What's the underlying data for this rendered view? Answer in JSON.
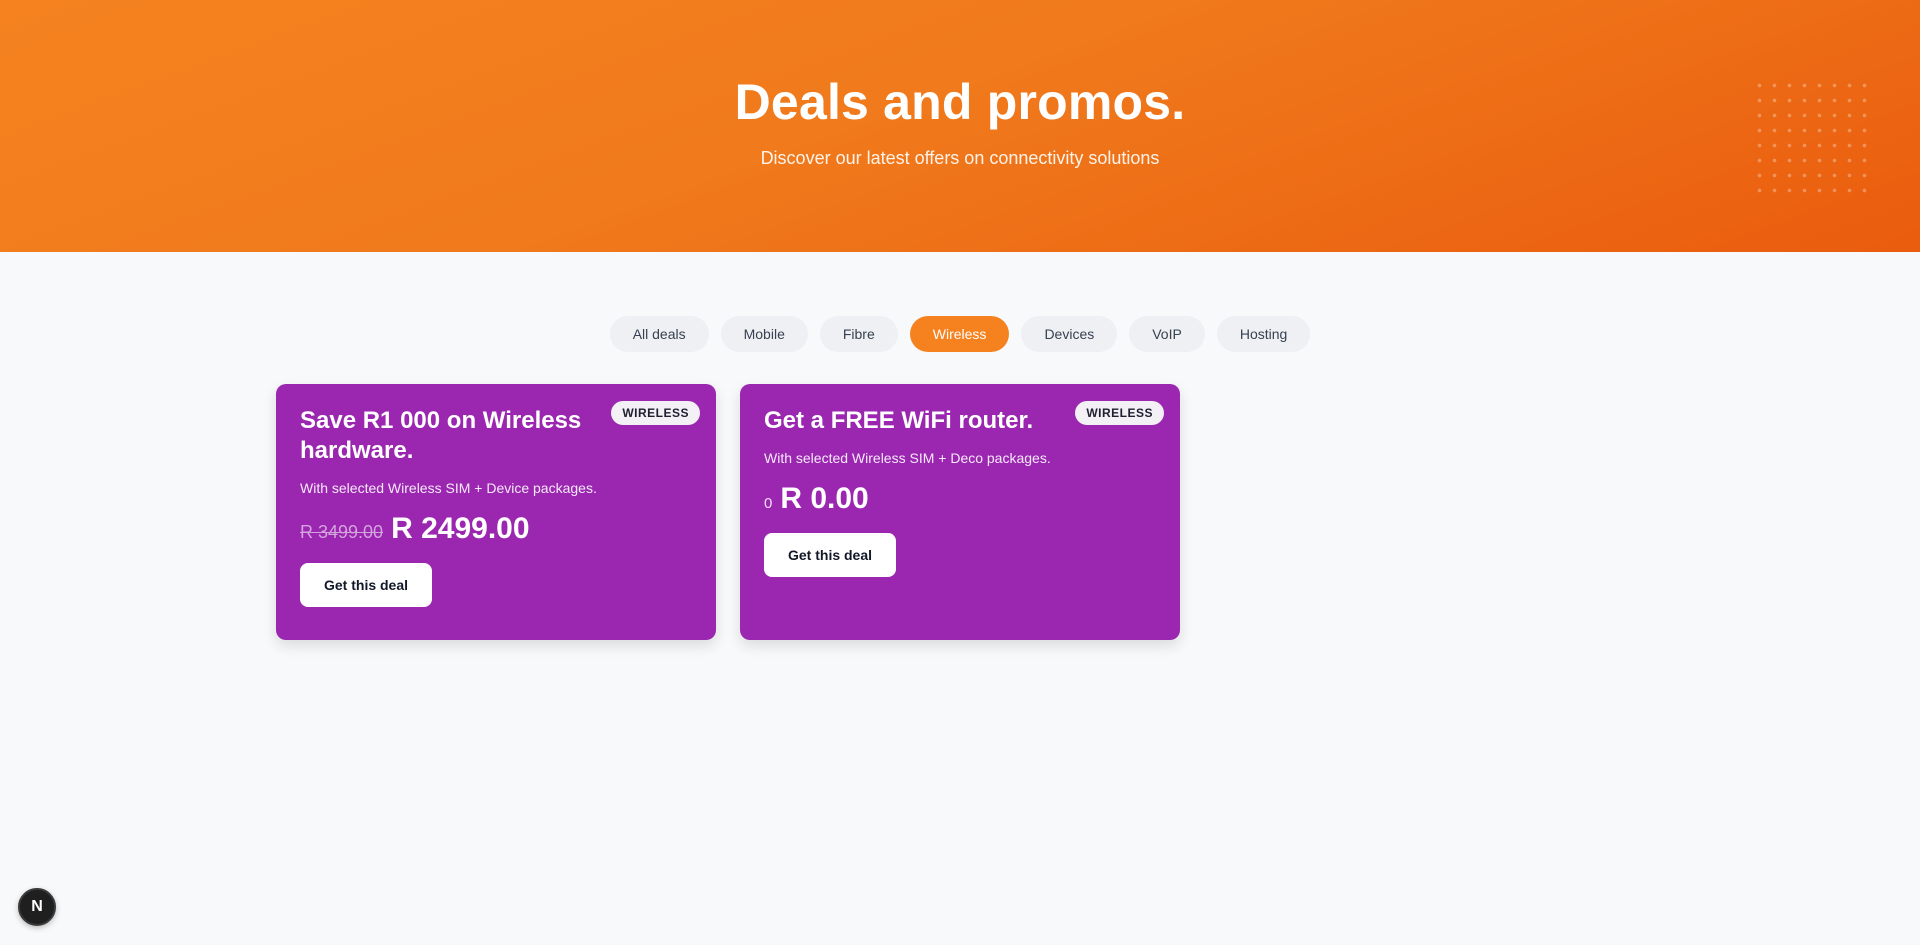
{
  "hero": {
    "title": "Deals and promos.",
    "subtitle": "Discover our latest offers on connectivity solutions"
  },
  "filters": {
    "items": [
      {
        "label": "All deals"
      },
      {
        "label": "Mobile"
      },
      {
        "label": "Fibre"
      },
      {
        "label": "Wireless"
      },
      {
        "label": "Devices"
      },
      {
        "label": "VoIP"
      },
      {
        "label": "Hosting"
      }
    ],
    "active": "Wireless"
  },
  "deals": [
    {
      "badge": "WIRELESS",
      "title": "Save R1 000 on Wireless hardware.",
      "description": "With selected Wireless SIM + Device packages.",
      "old_price": "R 3499.00",
      "price": "R 2499.00",
      "button": "Get this deal"
    },
    {
      "badge": "WIRELESS",
      "title": "Get a FREE WiFi router.",
      "description": "With selected Wireless SIM + Deco packages.",
      "price_prefix": "0",
      "price": "R 0.00",
      "button": "Get this deal"
    }
  ],
  "fab": {
    "label": "N"
  },
  "colors": {
    "brand_orange": "#f5821f",
    "card_purple": "#9b27b1",
    "background": "#f8f9fb"
  },
  "icons": {
    "fab_icon": "next-logo-icon"
  }
}
